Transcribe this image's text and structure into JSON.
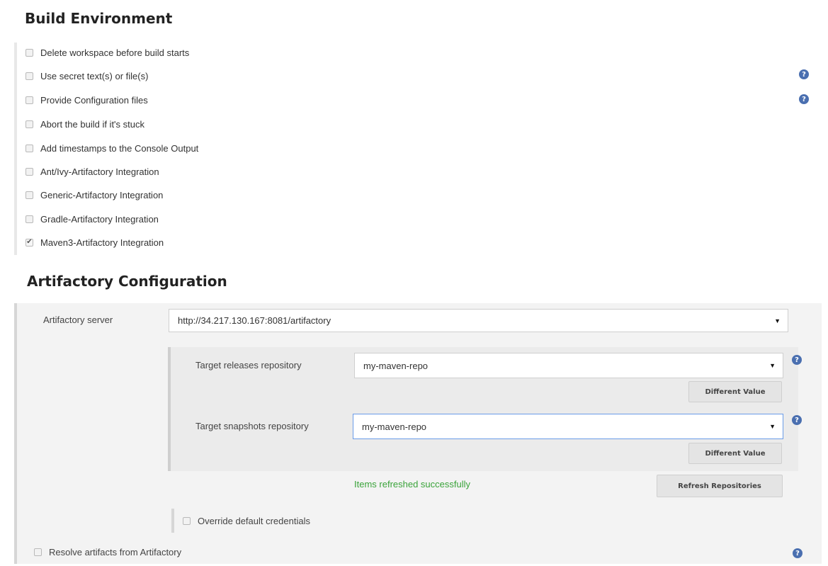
{
  "build_environment": {
    "title": "Build Environment",
    "options": [
      {
        "label": "Delete workspace before build starts",
        "checked": false,
        "help": false
      },
      {
        "label": "Use secret text(s) or file(s)",
        "checked": false,
        "help": true
      },
      {
        "label": "Provide Configuration files",
        "checked": false,
        "help": true
      },
      {
        "label": "Abort the build if it's stuck",
        "checked": false,
        "help": false
      },
      {
        "label": "Add timestamps to the Console Output",
        "checked": false,
        "help": false
      },
      {
        "label": "Ant/Ivy-Artifactory Integration",
        "checked": false,
        "help": false
      },
      {
        "label": "Generic-Artifactory Integration",
        "checked": false,
        "help": false
      },
      {
        "label": "Gradle-Artifactory Integration",
        "checked": false,
        "help": false
      },
      {
        "label": "Maven3-Artifactory Integration",
        "checked": true,
        "help": false
      }
    ]
  },
  "artifactory": {
    "title": "Artifactory Configuration",
    "server_label": "Artifactory server",
    "server_value": "http://34.217.130.167:8081/artifactory",
    "releases_label": "Target releases repository",
    "releases_value": "my-maven-repo",
    "snapshots_label": "Target snapshots repository",
    "snapshots_value": "my-maven-repo",
    "different_value_label": "Different Value",
    "refresh_button_label": "Refresh Repositories",
    "refresh_message": "Items refreshed successfully",
    "override_label": "Override default credentials",
    "resolve_label": "Resolve artifacts from Artifactory"
  },
  "icons": {
    "help": "help-icon",
    "dropdown": "dropdown-arrow-icon",
    "checkmark": "checkmark-icon"
  },
  "colors": {
    "help_icon": "#4a6fb0",
    "success_text": "#3aa33a",
    "focus_border": "#6a9ce8"
  }
}
